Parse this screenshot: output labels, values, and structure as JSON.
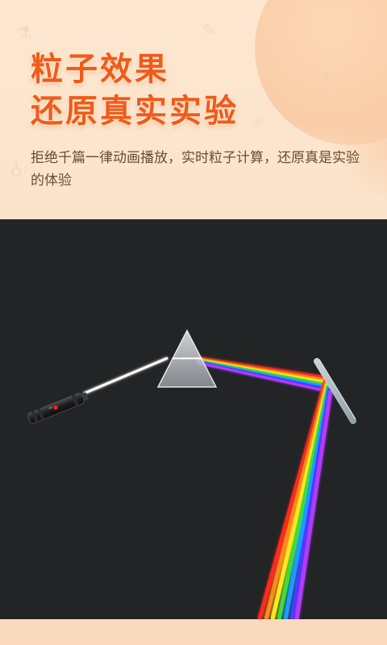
{
  "header": {
    "title_line1": "粒子效果",
    "title_line2": "还原真实实验",
    "subtitle": "拒绝千篇一律动画播放，实时粒子计算，还原真是实验的体验"
  },
  "scene": {
    "background_color": "#232426",
    "accent_color": "#ef5b1b",
    "spectrum_colors": [
      "#ff2a1a",
      "#ff8a1a",
      "#ffe81a",
      "#3ddc3a",
      "#1a9bff",
      "#4a3aff",
      "#b23aff"
    ]
  }
}
